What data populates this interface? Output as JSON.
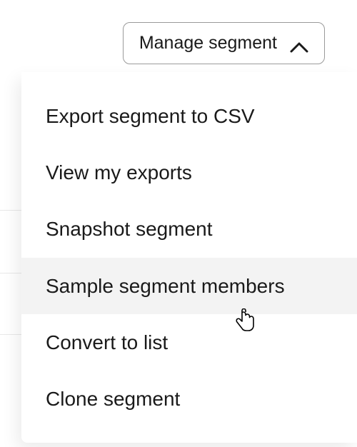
{
  "button": {
    "label": "Manage segment"
  },
  "menu": {
    "items": [
      {
        "label": "Export segment to CSV",
        "highlighted": false
      },
      {
        "label": "View my exports",
        "highlighted": false
      },
      {
        "label": "Snapshot segment",
        "highlighted": false
      },
      {
        "label": "Sample segment members",
        "highlighted": true
      },
      {
        "label": "Convert to list",
        "highlighted": false
      },
      {
        "label": "Clone segment",
        "highlighted": false
      }
    ]
  }
}
